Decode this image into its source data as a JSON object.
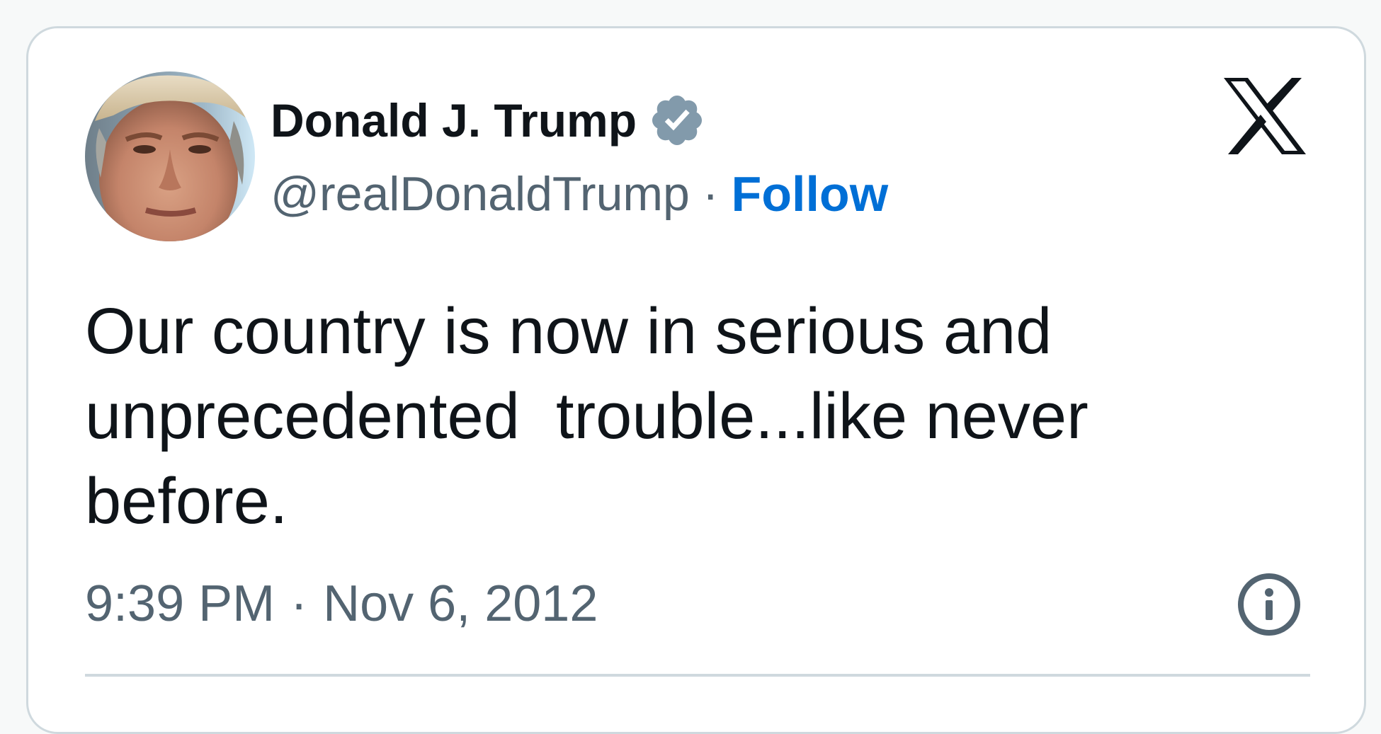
{
  "author": {
    "name": "Donald J. Trump",
    "handle": "@realDonaldTrump",
    "separator": "·",
    "follow_label": "Follow",
    "verified_icon": "verified-badge-icon",
    "avatar_icon": "avatar"
  },
  "platform": {
    "logo_icon": "x-logo-icon"
  },
  "tweet": {
    "text": "Our country is now in serious and unprecedented  trouble...like never before."
  },
  "meta": {
    "time": "9:39 PM",
    "separator": "·",
    "date": "Nov 6, 2012",
    "info_icon": "info-icon"
  },
  "colors": {
    "text_primary": "#0f1419",
    "text_secondary": "#536471",
    "link_blue": "#006fd6",
    "border": "#cfd9de",
    "verified_gray": "#829aab"
  }
}
